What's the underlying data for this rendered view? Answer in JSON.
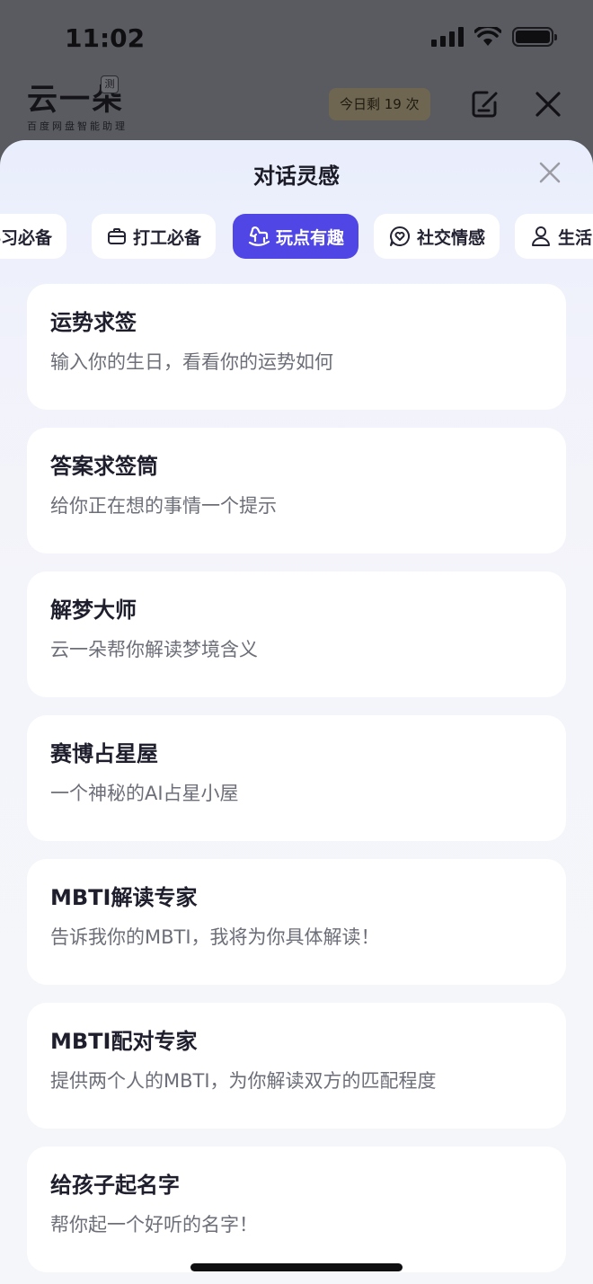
{
  "status_bar": {
    "time": "11:02"
  },
  "app_header": {
    "logo_text": "云一朵",
    "logo_badge": "测",
    "logo_subtitle": "百度网盘智能助理",
    "quota": "今日剩 19 次",
    "edit_icon": "edit-icon",
    "close_icon": "close-icon"
  },
  "sheet": {
    "title": "对话灵感",
    "close_icon": "close-icon",
    "tabs": [
      {
        "label": "学习必备",
        "icon": "book-icon",
        "active": false
      },
      {
        "label": "打工必备",
        "icon": "briefcase-icon",
        "active": false
      },
      {
        "label": "玩点有趣",
        "icon": "rocking-horse-icon",
        "active": true
      },
      {
        "label": "社交情感",
        "icon": "heart-chat-icon",
        "active": false
      },
      {
        "label": "生活",
        "icon": "person-icon",
        "active": false
      }
    ],
    "cards": [
      {
        "title": "运势求签",
        "desc": "输入你的生日，看看你的运势如何"
      },
      {
        "title": "答案求签筒",
        "desc": "给你正在想的事情一个提示"
      },
      {
        "title": "解梦大师",
        "desc": "云一朵帮你解读梦境含义"
      },
      {
        "title": "赛博占星屋",
        "desc": "一个神秘的AI占星小屋"
      },
      {
        "title": "MBTI解读专家",
        "desc": "告诉我你的MBTI，我将为你具体解读！"
      },
      {
        "title": "MBTI配对专家",
        "desc": "提供两个人的MBTI，为你解读双方的匹配程度"
      },
      {
        "title": "给孩子起名字",
        "desc": "帮你起一个好听的名字！"
      }
    ]
  },
  "colors": {
    "accent": "#4f46e5",
    "sheet_bg": "#f4f5fa",
    "card_bg": "#ffffff",
    "title_text": "#1e1e2c",
    "desc_text": "#6c6e78"
  }
}
